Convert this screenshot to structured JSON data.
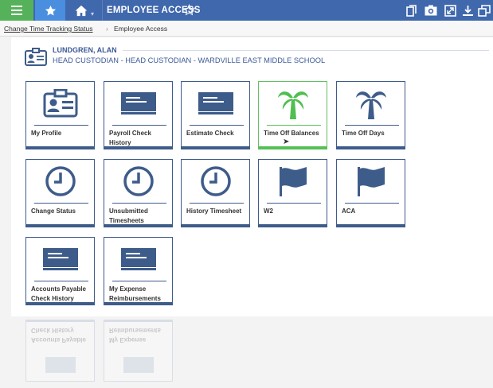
{
  "toolbar": {
    "title": "EMPLOYEE ACCESS",
    "menu_icon": "hamburger-icon",
    "favorites_icon": "star-icon",
    "home_icon": "home-icon",
    "bookmark_icon": "star-outline-icon",
    "right_icons": [
      "copy-icon",
      "camera-icon",
      "expand-icon",
      "download-icon",
      "new-window-icon"
    ]
  },
  "breadcrumb": {
    "link": "Change Time Tracking Status",
    "separator": "›",
    "current": "Employee Access"
  },
  "employee": {
    "name": "LUNDGREN, ALAN",
    "position": "HEAD CUSTODIAN - HEAD CUSTODIAN - WARDVILLE EAST MIDDLE SCHOOL"
  },
  "tiles": [
    {
      "label": "My Profile",
      "icon": "id-card-icon"
    },
    {
      "label": "Payroll Check History",
      "icon": "check-icon"
    },
    {
      "label": "Estimate Check",
      "icon": "check-icon"
    },
    {
      "label": "Time Off Balances",
      "icon": "palm-tree-icon",
      "active": true
    },
    {
      "label": "Time Off Days",
      "icon": "palm-tree-icon"
    },
    {
      "label": "Change Status",
      "icon": "clock-icon"
    },
    {
      "label": "Unsubmitted Timesheets",
      "icon": "clock-icon"
    },
    {
      "label": "History Timesheet",
      "icon": "clock-icon"
    },
    {
      "label": "W2",
      "icon": "flag-icon"
    },
    {
      "label": "ACA",
      "icon": "flag-icon"
    },
    {
      "label": "Accounts Payable Check History",
      "icon": "check-icon"
    },
    {
      "label": "My Expense Reimbursements",
      "icon": "check-icon"
    }
  ],
  "colors": {
    "toolbar": "#3f68ad",
    "menu_green": "#56b25a",
    "favorites_blue": "#4a8ee0",
    "tile_blue": "#3e5c8a",
    "active_green": "#56c056"
  }
}
